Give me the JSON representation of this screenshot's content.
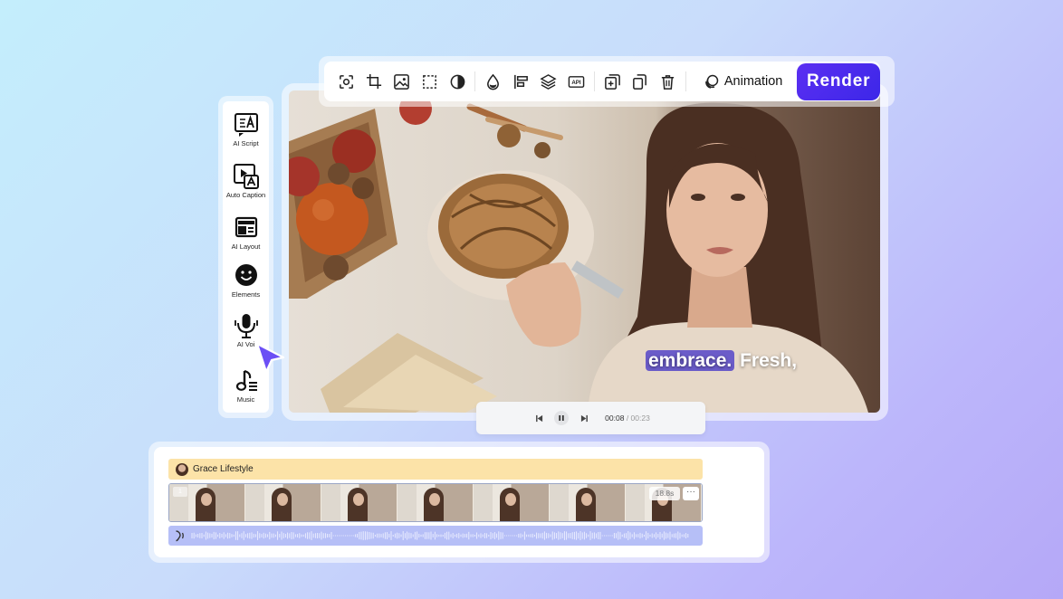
{
  "sidebar": {
    "items": [
      {
        "label": "AI Script",
        "icon": "ai-script-icon"
      },
      {
        "label": "Auto Caption",
        "icon": "auto-caption-icon"
      },
      {
        "label": "AI Layout",
        "icon": "ai-layout-icon"
      },
      {
        "label": "Elements",
        "icon": "smiley-icon"
      },
      {
        "label": "AI Voi",
        "icon": "microphone-icon"
      },
      {
        "label": "Music",
        "icon": "music-note-icon"
      }
    ]
  },
  "toolbar": {
    "icons": [
      "focus-icon",
      "crop-icon",
      "image-icon",
      "selection-icon",
      "contrast-icon",
      "drop-icon",
      "align-left-icon",
      "layers-icon",
      "api-icon",
      "add-copy-icon",
      "duplicate-icon",
      "trash-icon"
    ],
    "api_text": "API",
    "animation_label": "Animation",
    "render_label": "Render"
  },
  "caption": {
    "highlight": "embrace.",
    "rest": " Fresh,"
  },
  "playback": {
    "current_time": "00:08",
    "separator": " / ",
    "total_time": "00:23"
  },
  "timeline": {
    "track_name": "Grace Lifestyle",
    "clip_number": "1",
    "clip_duration": "18.8s",
    "more_label": "···"
  },
  "colors": {
    "accent": "#4a2ff0",
    "track_title_bg": "#fce3a8",
    "audio_bg": "#b6bff7",
    "caption_highlight": "#6b5cc9"
  }
}
